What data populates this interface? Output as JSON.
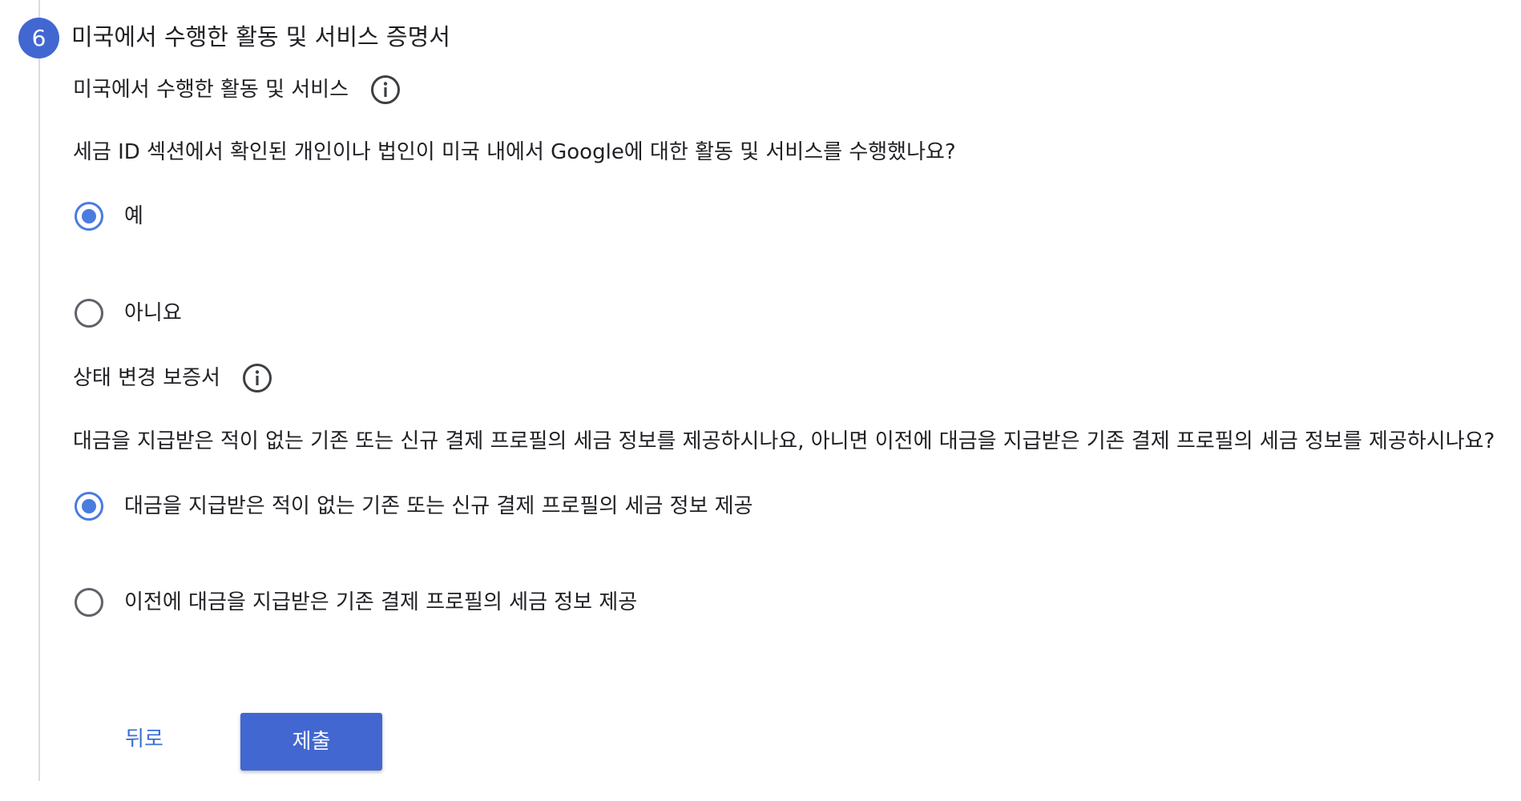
{
  "step": {
    "number": "6",
    "title": "미국에서 수행한 활동 및 서비스 증명서"
  },
  "activities": {
    "label": "미국에서 수행한 활동 및 서비스",
    "info_icon": "info-circle-icon",
    "question": "세금 ID 섹션에서 확인된 개인이나 법인이 미국 내에서 Google에 대한 활동 및 서비스를 수행했나요?",
    "options": [
      {
        "label": "예",
        "selected": true
      },
      {
        "label": "아니요",
        "selected": false
      }
    ]
  },
  "status_change": {
    "label": "상태 변경 보증서",
    "info_icon": "info-circle-icon",
    "question": "대금을 지급받은 적이 없는 기존 또는 신규 결제 프로필의 세금 정보를 제공하시나요, 아니면 이전에 대금을 지급받은 기존 결제 프로필의 세금 정보를 제공하시나요?",
    "options": [
      {
        "label": "대금을 지급받은 적이 없는 기존 또는 신규 결제 프로필의 세금 정보 제공",
        "selected": true
      },
      {
        "label": "이전에 대금을 지급받은 기존 결제 프로필의 세금 정보 제공",
        "selected": false
      }
    ]
  },
  "buttons": {
    "back_label": "뒤로",
    "submit_label": "제출"
  },
  "colors": {
    "primary": "#4267d1",
    "radio_selected": "#4a7be0",
    "link": "#3a6fd8",
    "text": "#202124"
  }
}
